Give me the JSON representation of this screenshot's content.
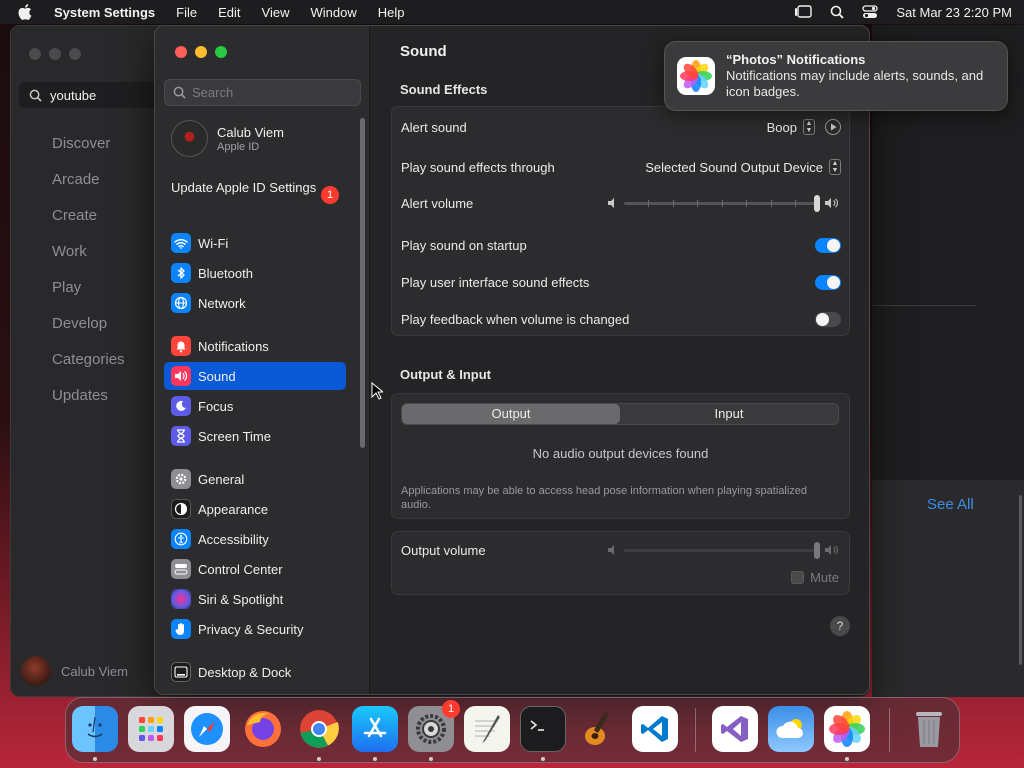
{
  "menubar": {
    "app_name": "System Settings",
    "menus": [
      "File",
      "Edit",
      "View",
      "Window",
      "Help"
    ],
    "datetime": "Sat Mar 23  2:20 PM"
  },
  "background_app": {
    "search_value": "youtube",
    "nav": [
      "Discover",
      "Arcade",
      "Create",
      "Work",
      "Play",
      "Develop",
      "Categories",
      "Updates"
    ],
    "user_name": "Calub Viem",
    "see_all": "See All"
  },
  "sidebar": {
    "search_placeholder": "Search",
    "account": {
      "name": "Calub Viem",
      "subtitle": "Apple ID"
    },
    "update": {
      "label": "Update Apple ID Settings",
      "badge": "1"
    },
    "items": [
      {
        "label": "Wi-Fi",
        "icon": "wifi-icon",
        "color": "#0a84ff"
      },
      {
        "label": "Bluetooth",
        "icon": "bluetooth-icon",
        "color": "#0a84ff"
      },
      {
        "label": "Network",
        "icon": "globe-icon",
        "color": "#0a84ff"
      },
      {
        "label": "Notifications",
        "icon": "bell-icon",
        "color": "#ff453a"
      },
      {
        "label": "Sound",
        "icon": "speaker-icon",
        "color": "#ff375f",
        "active": true
      },
      {
        "label": "Focus",
        "icon": "moon-icon",
        "color": "#5e5ce6"
      },
      {
        "label": "Screen Time",
        "icon": "hourglass-icon",
        "color": "#5e5ce6"
      },
      {
        "label": "General",
        "icon": "gear-icon",
        "color": "#8e8e93"
      },
      {
        "label": "Appearance",
        "icon": "appearance-icon",
        "color": "#1c1c1e"
      },
      {
        "label": "Accessibility",
        "icon": "accessibility-icon",
        "color": "#0a84ff"
      },
      {
        "label": "Control Center",
        "icon": "control-center-icon",
        "color": "#8e8e93"
      },
      {
        "label": "Siri & Spotlight",
        "icon": "siri-icon",
        "color": "#bf5af2"
      },
      {
        "label": "Privacy & Security",
        "icon": "hand-icon",
        "color": "#0a84ff"
      },
      {
        "label": "Desktop & Dock",
        "icon": "dock-icon",
        "color": "#1c1c1e"
      }
    ]
  },
  "content": {
    "title": "Sound",
    "sound_effects": {
      "heading": "Sound Effects",
      "alert_sound": {
        "label": "Alert sound",
        "value": "Boop"
      },
      "play_through": {
        "label": "Play sound effects through",
        "value": "Selected Sound Output Device"
      },
      "alert_volume": {
        "label": "Alert volume",
        "level": 1.0
      },
      "toggles": [
        {
          "label": "Play sound on startup",
          "on": true
        },
        {
          "label": "Play user interface sound effects",
          "on": true
        },
        {
          "label": "Play feedback when volume is changed",
          "on": false
        }
      ]
    },
    "output_input": {
      "heading": "Output & Input",
      "tabs": [
        "Output",
        "Input"
      ],
      "selected_tab": "Output",
      "empty_message": "No audio output devices found",
      "note": "Applications may be able to access head pose information when playing spatialized audio.",
      "output_volume": {
        "label": "Output volume",
        "level": 1.0
      },
      "mute_label": "Mute"
    },
    "help": "?"
  },
  "notification": {
    "title": "“Photos” Notifications",
    "body": "Notifications may include alerts, sounds, and icon badges."
  },
  "dock": {
    "apps": [
      {
        "name": "finder-icon",
        "running": true
      },
      {
        "name": "launchpad-icon",
        "running": false
      },
      {
        "name": "safari-icon",
        "running": false
      },
      {
        "name": "firefox-icon",
        "running": false
      },
      {
        "name": "chrome-icon",
        "running": true
      },
      {
        "name": "app-store-icon",
        "running": true
      },
      {
        "name": "system-settings-icon",
        "running": true,
        "badge": "1"
      },
      {
        "name": "textedit-icon",
        "running": false
      },
      {
        "name": "terminal-icon",
        "running": true
      },
      {
        "name": "garageband-icon",
        "running": false
      },
      {
        "name": "vscode-icon",
        "running": false
      },
      {
        "name": "visual-studio-icon",
        "running": false
      },
      {
        "name": "weather-icon",
        "running": false
      },
      {
        "name": "photos-icon",
        "running": true
      },
      {
        "name": "trash-icon",
        "running": false
      }
    ]
  }
}
